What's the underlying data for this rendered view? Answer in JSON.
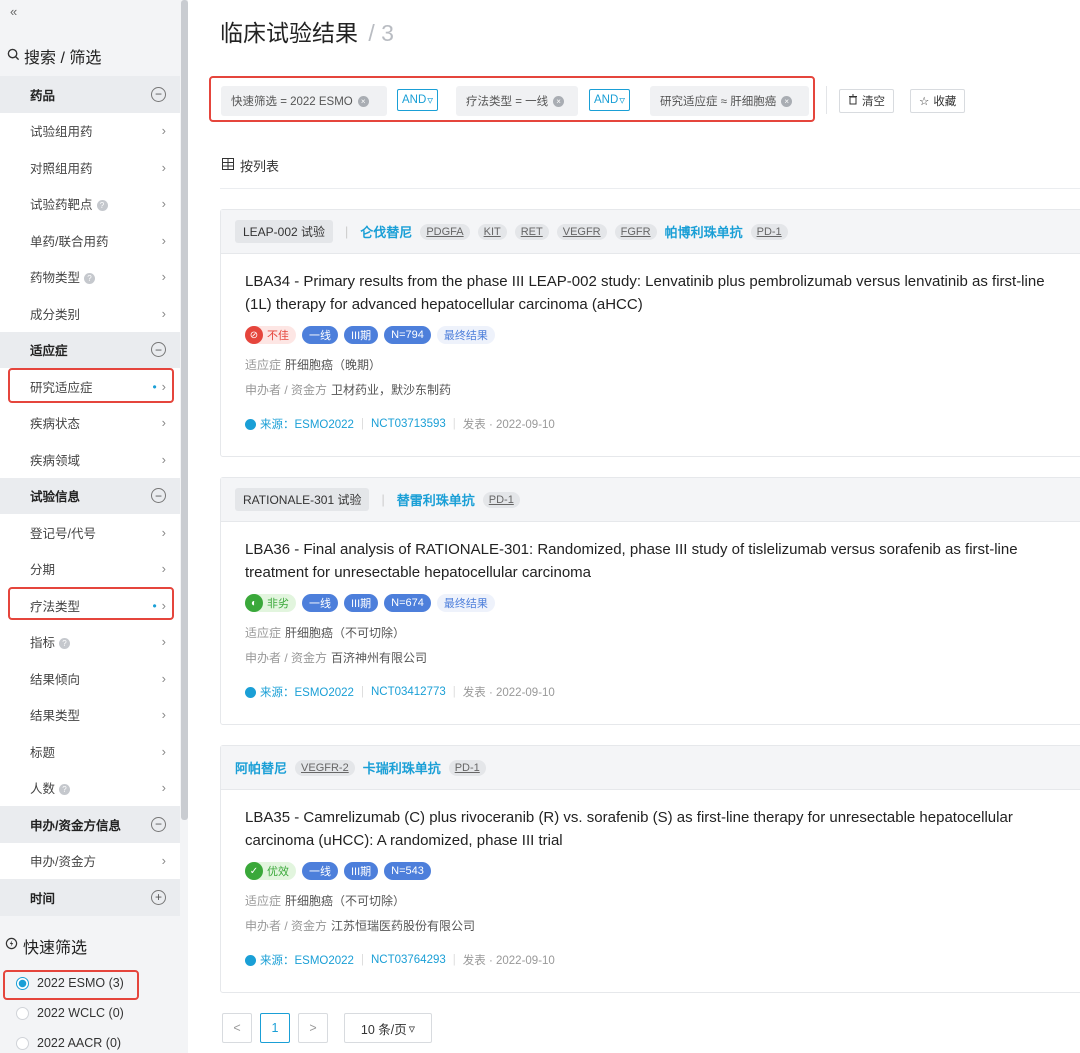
{
  "sidebar": {
    "collapse_icon": "«",
    "search_title": "搜索 / 筛选",
    "rows": [
      {
        "label": "药品",
        "type": "group",
        "toggle": "−"
      },
      {
        "label": "试验组用药",
        "type": "item"
      },
      {
        "label": "对照组用药",
        "type": "item"
      },
      {
        "label": "试验药靶点",
        "type": "item",
        "help": true
      },
      {
        "label": "单药/联合用药",
        "type": "item"
      },
      {
        "label": "药物类型",
        "type": "item",
        "help": true
      },
      {
        "label": "成分类别",
        "type": "item"
      },
      {
        "label": "适应症",
        "type": "group",
        "toggle": "−"
      },
      {
        "label": "研究适应症",
        "type": "item",
        "active": true
      },
      {
        "label": "疾病状态",
        "type": "item"
      },
      {
        "label": "疾病领域",
        "type": "item"
      },
      {
        "label": "试验信息",
        "type": "group",
        "toggle": "−"
      },
      {
        "label": "登记号/代号",
        "type": "item"
      },
      {
        "label": "分期",
        "type": "item"
      },
      {
        "label": "疗法类型",
        "type": "item",
        "active": true
      },
      {
        "label": "指标",
        "type": "item",
        "help": true
      },
      {
        "label": "结果倾向",
        "type": "item"
      },
      {
        "label": "结果类型",
        "type": "item"
      },
      {
        "label": "标题",
        "type": "item"
      },
      {
        "label": "人数",
        "type": "item",
        "help": true
      },
      {
        "label": "申办/资金方信息",
        "type": "group",
        "toggle": "−"
      },
      {
        "label": "申办/资金方",
        "type": "item"
      },
      {
        "label": "时间",
        "type": "group",
        "toggle": "+"
      }
    ],
    "quick_title": "快速筛选",
    "quick_options": [
      {
        "label": "2022 ESMO (3)",
        "selected": true
      },
      {
        "label": "2022 WCLC (0)",
        "selected": false
      },
      {
        "label": "2022 AACR (0)",
        "selected": false
      }
    ]
  },
  "header": {
    "title": "临床试验结果",
    "count_sep": "/",
    "count": "3"
  },
  "filters": {
    "chips": [
      "快速筛选 = 2022 ESMO",
      "疗法类型 = 一线",
      "研究适应症 ≈ 肝细胞癌"
    ],
    "and_label": "AND",
    "clear_label": "清空",
    "save_label": "收藏"
  },
  "view_label": "按列表",
  "cards": [
    {
      "trial": "LEAP-002 试验",
      "drugs": [
        {
          "name": "仑伐替尼",
          "targets": [
            "PDGFA",
            "KIT",
            "RET",
            "VEGFR",
            "FGFR"
          ]
        },
        {
          "name": "帕博利珠单抗",
          "targets": [
            "PD-1"
          ]
        }
      ],
      "title": "LBA34 - Primary results from the phase III LEAP-002 study: Lenvatinib plus pembrolizumab versus lenvatinib as first-line (1L) therapy for advanced hepatocellular carcinoma (aHCC)",
      "result": {
        "label": "不佳",
        "kind": "result-bad",
        "icon": "⊘"
      },
      "tags": [
        "一线",
        "III期",
        "N=794"
      ],
      "final": "最终结果",
      "indication_label": "适应症",
      "indication": "肝细胞癌（晚期）",
      "sponsor_label": "申办者 / 资金方",
      "sponsor": "卫材药业，默沙东制药",
      "source": "来源：ESMO2022",
      "nct": "NCT03713593",
      "published": "发表 · 2022-09-10"
    },
    {
      "trial": "RATIONALE-301 试验",
      "drugs": [
        {
          "name": "替雷利珠单抗",
          "targets": [
            "PD-1"
          ]
        }
      ],
      "title": "LBA36 - Final analysis of RATIONALE-301: Randomized, phase III study of tislelizumab versus sorafenib as first-line treatment for unresectable hepatocellular carcinoma",
      "result": {
        "label": "非劣",
        "kind": "result-ni",
        "icon": "◐"
      },
      "tags": [
        "一线",
        "III期",
        "N=674"
      ],
      "final": "最终结果",
      "indication_label": "适应症",
      "indication": "肝细胞癌（不可切除）",
      "sponsor_label": "申办者 / 资金方",
      "sponsor": "百济神州有限公司",
      "source": "来源：ESMO2022",
      "nct": "NCT03412773",
      "published": "发表 · 2022-09-10"
    },
    {
      "trial": "",
      "drugs": [
        {
          "name": "阿帕替尼",
          "targets": [
            "VEGFR-2"
          ]
        },
        {
          "name": "卡瑞利珠单抗",
          "targets": [
            "PD-1"
          ]
        }
      ],
      "title": "LBA35 - Camrelizumab (C) plus rivoceranib (R) vs. sorafenib (S) as first-line therapy for unresectable hepatocellular carcinoma (uHCC): A randomized, phase III trial",
      "result": {
        "label": "优效",
        "kind": "result-good",
        "icon": "✓"
      },
      "tags": [
        "一线",
        "III期",
        "N=543"
      ],
      "final": "",
      "indication_label": "适应症",
      "indication": "肝细胞癌（不可切除）",
      "sponsor_label": "申办者 / 资金方",
      "sponsor": "江苏恒瑞医药股份有限公司",
      "source": "来源：ESMO2022",
      "nct": "NCT03764293",
      "published": "发表 · 2022-09-10"
    }
  ],
  "pagination": {
    "prev": "<",
    "current": "1",
    "next": ">",
    "page_size": "10 条/页"
  }
}
